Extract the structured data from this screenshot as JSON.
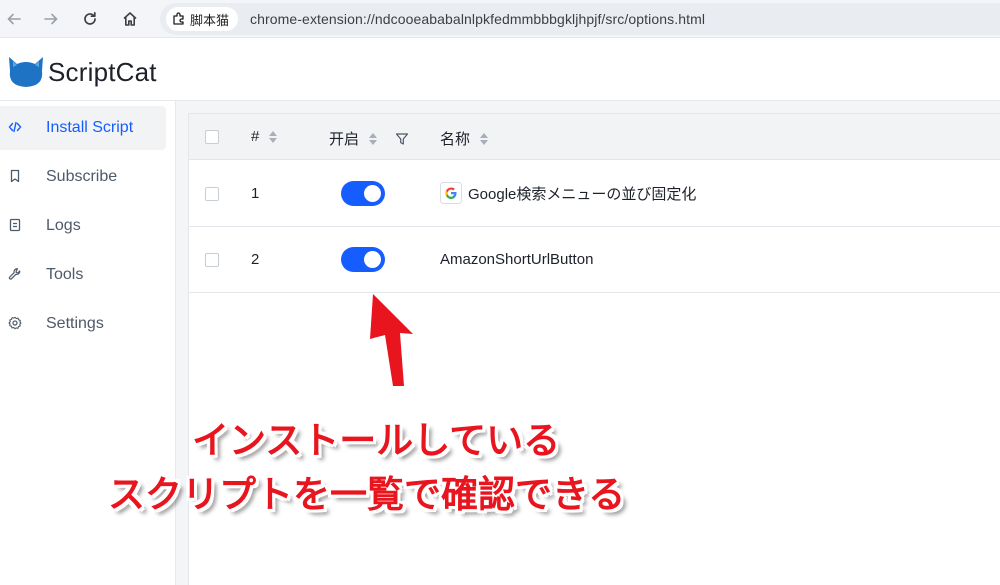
{
  "browser": {
    "site_name": "脚本猫",
    "url": "chrome-extension://ndcooeababalnlpkfedmmbbbgkljhpjf/src/options.html"
  },
  "app": {
    "brand": "ScriptCat",
    "accent_color": "#165dff"
  },
  "sidebar": {
    "items": [
      {
        "label": "Install Script",
        "icon": "code-icon",
        "active": true
      },
      {
        "label": "Subscribe",
        "icon": "bookmark-icon",
        "active": false
      },
      {
        "label": "Logs",
        "icon": "file-text-icon",
        "active": false
      },
      {
        "label": "Tools",
        "icon": "wrench-icon",
        "active": false
      },
      {
        "label": "Settings",
        "icon": "gear-icon",
        "active": false
      }
    ]
  },
  "table": {
    "columns": {
      "index": "#",
      "enabled": "开启",
      "name": "名称"
    },
    "rows": [
      {
        "index": "1",
        "enabled": true,
        "name": "Google検索メニューの並び固定化",
        "icon": "google-icon"
      },
      {
        "index": "2",
        "enabled": true,
        "name": "AmazonShortUrlButton",
        "icon": ""
      }
    ]
  },
  "annotation": {
    "line1": "インストールしている",
    "line2": "スクリプトを一覧で確認できる",
    "color": "#e8141e"
  }
}
